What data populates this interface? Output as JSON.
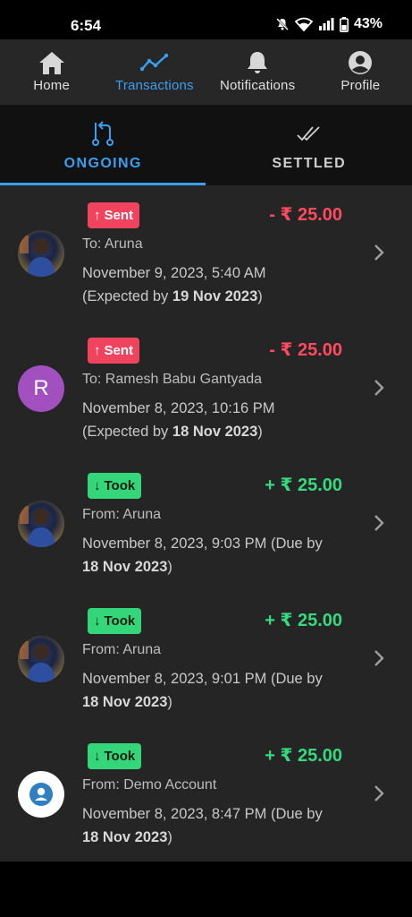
{
  "status_bar": {
    "time": "6:54",
    "battery": "43%",
    "icons": [
      "mute-icon",
      "wifi-icon",
      "signal-icon",
      "battery-icon"
    ]
  },
  "nav": {
    "items": [
      {
        "label": "Home",
        "icon": "home-icon",
        "active": false
      },
      {
        "label": "Transactions",
        "icon": "chart-line-icon",
        "active": true
      },
      {
        "label": "Notifications",
        "icon": "bell-icon",
        "active": false
      },
      {
        "label": "Profile",
        "icon": "profile-icon",
        "active": false
      }
    ]
  },
  "tabs": {
    "ongoing": "ONGOING",
    "settled": "SETTLED"
  },
  "colors": {
    "accent": "#3b9ff0",
    "sent": "#f0445e",
    "took": "#35d67a",
    "avatar_letter_bg": "#a24fc0"
  },
  "transactions": [
    {
      "type": "Sent",
      "amount": "- ₹ 25.00",
      "party": "To: Aruna",
      "datetime": "November 9, 2023, 5:40 AM",
      "expected_prefix": "(Expected by ",
      "expected_date": "19 Nov 2023",
      "expected_suffix": ")",
      "avatar": "photo"
    },
    {
      "type": "Sent",
      "amount": "- ₹ 25.00",
      "party": "To: Ramesh Babu Gantyada",
      "datetime": "November 8, 2023, 10:16 PM",
      "expected_prefix": "(Expected by ",
      "expected_date": "18 Nov 2023",
      "expected_suffix": ")",
      "avatar": "R"
    },
    {
      "type": "Took",
      "amount": "+ ₹ 25.00",
      "party": "From: Aruna",
      "datetime": "November 8, 2023, 9:03 PM (Due by",
      "expected_prefix": "",
      "expected_date": "18 Nov 2023",
      "expected_suffix": ")",
      "avatar": "photo"
    },
    {
      "type": "Took",
      "amount": "+ ₹ 25.00",
      "party": "From: Aruna",
      "datetime": "November 8, 2023, 9:01 PM (Due by",
      "expected_prefix": "",
      "expected_date": "18 Nov 2023",
      "expected_suffix": ")",
      "avatar": "photo"
    },
    {
      "type": "Took",
      "amount": "+ ₹ 25.00",
      "party": "From: Demo Account",
      "datetime": "November 8, 2023, 8:47 PM (Due by",
      "expected_prefix": "",
      "expected_date": "18 Nov 2023",
      "expected_suffix": ")",
      "avatar": "demo"
    }
  ]
}
